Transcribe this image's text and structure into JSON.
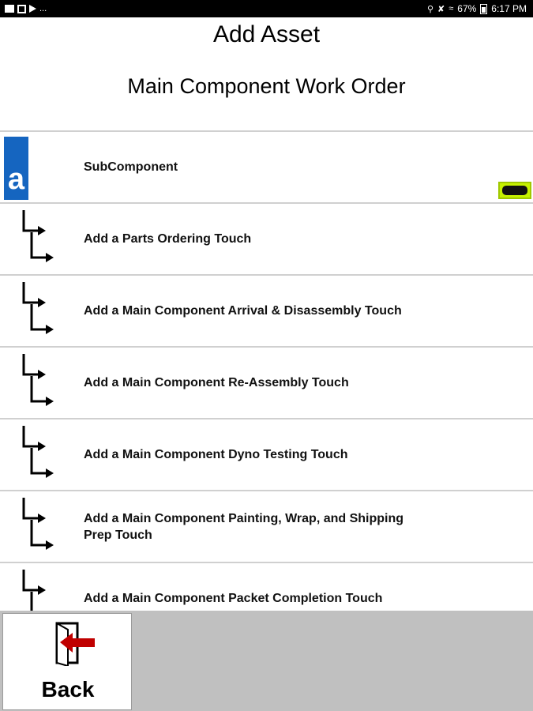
{
  "status_bar": {
    "left_icons": [
      "image-icon",
      "flag-icon",
      "play-store-icon"
    ],
    "overflow_dots": "...",
    "right_icons": [
      "location-icon",
      "mute-icon",
      "wifi-icon"
    ],
    "battery_percent": "67%",
    "time": "6:17 PM"
  },
  "header": {
    "title": "Add Asset",
    "subtitle": "Main Component Work Order"
  },
  "list": {
    "items": [
      {
        "label": "SubComponent",
        "icon": "app-logo-icon",
        "badge_icon": "battery-badge-icon"
      },
      {
        "label": "Add a Parts Ordering Touch",
        "icon": "branch-arrow-icon"
      },
      {
        "label": "Add a Main Component Arrival & Disassembly Touch",
        "icon": "branch-arrow-icon"
      },
      {
        "label": "Add a Main Component Re-Assembly Touch",
        "icon": "branch-arrow-icon"
      },
      {
        "label": "Add a Main Component Dyno Testing Touch",
        "icon": "branch-arrow-icon"
      },
      {
        "label": "Add a Main Component Painting, Wrap, and Shipping Prep Touch",
        "icon": "branch-arrow-icon"
      },
      {
        "label": "Add a Main Component Packet Completion Touch",
        "icon": "branch-arrow-icon"
      }
    ],
    "logo_letter": "a"
  },
  "footer": {
    "back_label": "Back",
    "back_icon": "exit-arrow-icon"
  },
  "colors": {
    "logo_blue": "#1565c0",
    "badge_green": "#c6f200",
    "back_arrow_red": "#c00000",
    "footer_gray": "#c0c0c0"
  }
}
